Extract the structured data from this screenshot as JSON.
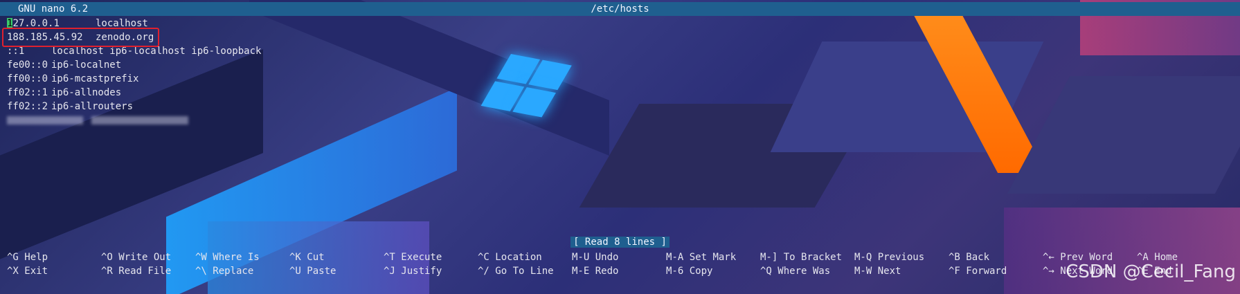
{
  "titlebar": {
    "version": "GNU nano 6.2",
    "filename": "/etc/hosts"
  },
  "editor": {
    "lines": [
      {
        "addr": "127.0.0.1",
        "host": "localhost"
      },
      {
        "addr": "188.185.45.92",
        "host": "zenodo.org"
      },
      {
        "addr": "::1",
        "host": "localhost ip6-localhost ip6-loopback"
      },
      {
        "addr": "fe00::0",
        "host": "ip6-localnet"
      },
      {
        "addr": "ff00::0",
        "host": "ip6-mcastprefix"
      },
      {
        "addr": "ff02::1",
        "host": "ip6-allnodes"
      },
      {
        "addr": "ff02::2",
        "host": "ip6-allrouters"
      }
    ]
  },
  "status": "[ Read 8 lines ]",
  "shortcuts": [
    [
      {
        "key": "^G",
        "label": "Help"
      },
      {
        "key": "^O",
        "label": "Write Out"
      },
      {
        "key": "^W",
        "label": "Where Is"
      },
      {
        "key": "^K",
        "label": "Cut"
      },
      {
        "key": "^T",
        "label": "Execute"
      },
      {
        "key": "^C",
        "label": "Location"
      },
      {
        "key": "M-U",
        "label": "Undo"
      },
      {
        "key": "M-A",
        "label": "Set Mark"
      },
      {
        "key": "M-]",
        "label": "To Bracket"
      },
      {
        "key": "M-Q",
        "label": "Previous"
      },
      {
        "key": "^B",
        "label": "Back"
      },
      {
        "key": "^←",
        "label": "Prev Word"
      },
      {
        "key": "^A",
        "label": "Home"
      }
    ],
    [
      {
        "key": "^X",
        "label": "Exit"
      },
      {
        "key": "^R",
        "label": "Read File"
      },
      {
        "key": "^\\",
        "label": "Replace"
      },
      {
        "key": "^U",
        "label": "Paste"
      },
      {
        "key": "^J",
        "label": "Justify"
      },
      {
        "key": "^/",
        "label": "Go To Line"
      },
      {
        "key": "M-E",
        "label": "Redo"
      },
      {
        "key": "M-6",
        "label": "Copy"
      },
      {
        "key": "^Q",
        "label": "Where Was"
      },
      {
        "key": "M-W",
        "label": "Next"
      },
      {
        "key": "^F",
        "label": "Forward"
      },
      {
        "key": "^→",
        "label": "Next Word"
      },
      {
        "key": "^E",
        "label": "End"
      }
    ]
  ],
  "watermark": "CSDN @Cecil_Fang",
  "colors": {
    "titlebar": "#1f5f8f",
    "cursor": "#3cc76b",
    "highlight": "#e0202e"
  }
}
